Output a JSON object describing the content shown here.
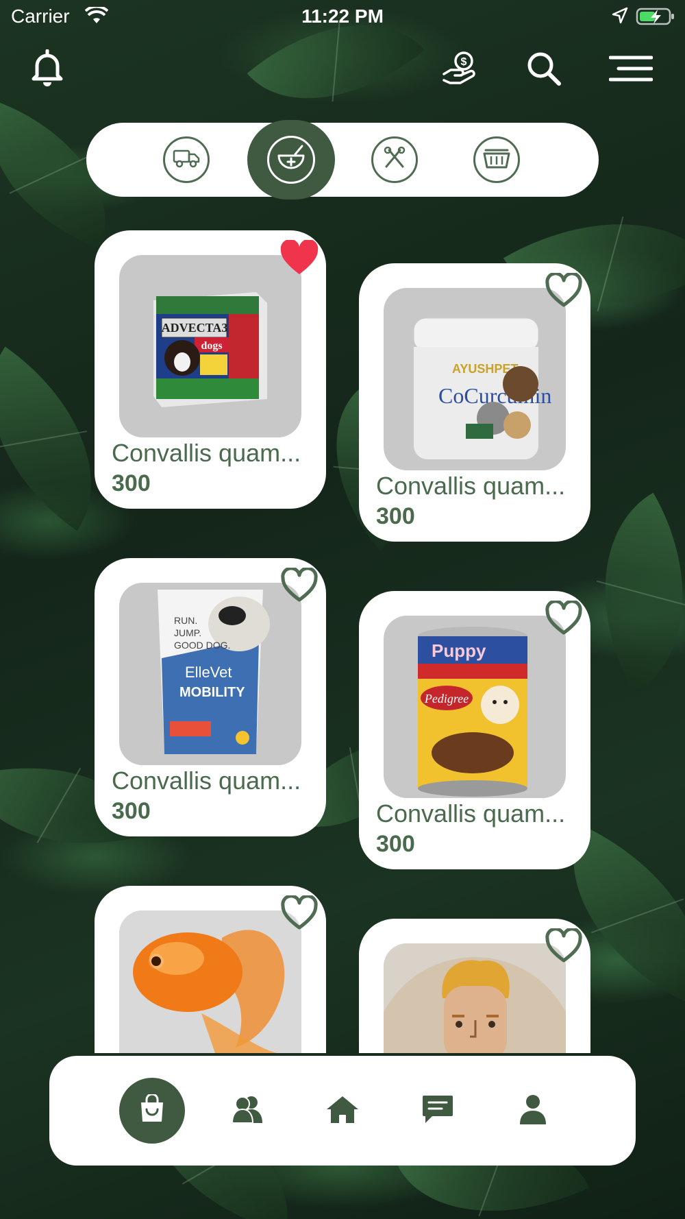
{
  "status_bar": {
    "carrier": "Carrier",
    "time": "11:22 PM"
  },
  "colors": {
    "brand_green": "#3f5a41",
    "text_green": "#4a6a4d",
    "favorite_red": "#f0344c",
    "card_bg": "#ffffff"
  },
  "header": {
    "icons": [
      "bell-icon",
      "donate-icon",
      "search-icon",
      "menu-icon"
    ]
  },
  "categories": [
    {
      "icon": "truck-icon",
      "active": false
    },
    {
      "icon": "mortar-pestle-icon",
      "active": true
    },
    {
      "icon": "grooming-tools-icon",
      "active": false
    },
    {
      "icon": "basket-icon",
      "active": false
    }
  ],
  "products": [
    {
      "name": "Convallis quam...",
      "price": "300",
      "favorite": true,
      "image": "advecta-dogs-box"
    },
    {
      "name": "Convallis quam...",
      "price": "300",
      "favorite": false,
      "image": "cocurcumin-jar"
    },
    {
      "name": "Convallis quam...",
      "price": "300",
      "favorite": false,
      "image": "ellevet-mobility-bag"
    },
    {
      "name": "Convallis quam...",
      "price": "300",
      "favorite": false,
      "image": "pedigree-puppy-can"
    },
    {
      "favorite": false,
      "image": "goldfish"
    },
    {
      "favorite": false,
      "image": "man-avatar"
    }
  ],
  "bottom_nav": [
    {
      "icon": "shopping-bag-icon",
      "active": true
    },
    {
      "icon": "people-icon",
      "active": false
    },
    {
      "icon": "home-icon",
      "active": false
    },
    {
      "icon": "chat-icon",
      "active": false
    },
    {
      "icon": "profile-icon",
      "active": false
    }
  ]
}
